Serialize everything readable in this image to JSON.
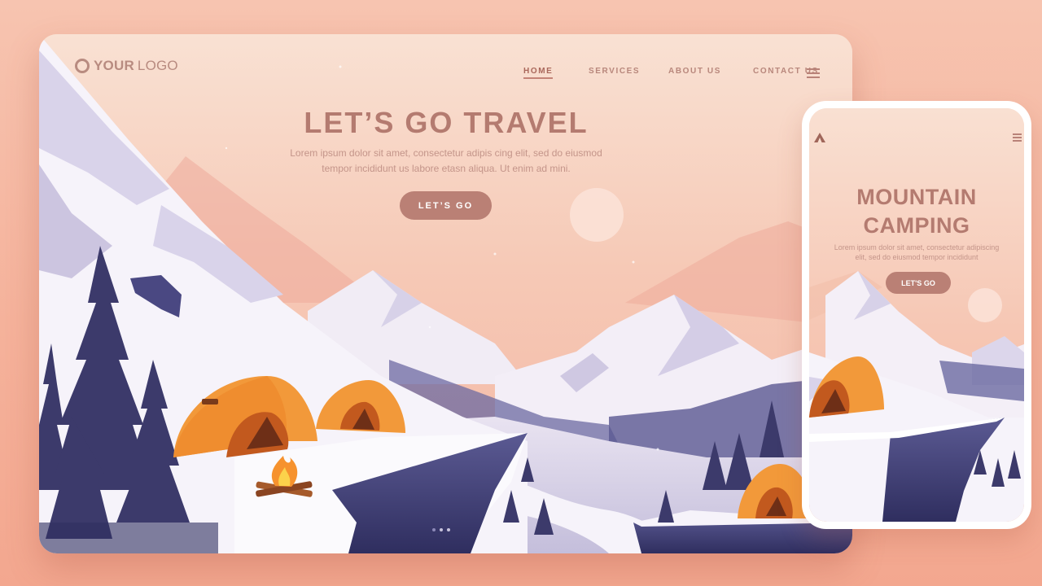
{
  "desktop": {
    "logo": {
      "bold": "YOUR",
      "regular": "LOGO"
    },
    "nav": [
      {
        "label": "HOME",
        "active": true
      },
      {
        "label": "SERVICES",
        "active": false
      },
      {
        "label": "ABOUT US",
        "active": false
      },
      {
        "label": "CONTACT US",
        "active": false
      }
    ],
    "hero": {
      "title": "LET’S GO TRAVEL",
      "subtitle_line1": "Lorem ipsum dolor sit amet, consectetur adipis cing elit, sed do eiusmod",
      "subtitle_line2": "tempor incididunt us labore etasn aliqua. Ut enim ad mini.",
      "button_label": "LET’S GO"
    },
    "carousel": {
      "slide_count": 3,
      "active_index": 0
    },
    "icons": [
      "logo-ring-icon",
      "menu-icon",
      "campfire-icon"
    ]
  },
  "mobile": {
    "title_line1": "MOUNTAIN",
    "title_line2": "CAMPING",
    "subtitle_line1": "Lorem ipsum dolor sit amet, consectetur adipiscing",
    "subtitle_line2": "elit, sed do eiusmod tempor incididunt",
    "button_label": "LET'S GO",
    "icons": [
      "tent-logo-icon",
      "menu-icon"
    ]
  },
  "colors": {
    "background": "#f5b29b",
    "sky_top": "#f9e1d3",
    "sky_bottom": "#f4b7a4",
    "title": "#b47b70",
    "button": "#ba8075",
    "tent": "#f29a3a",
    "tree": "#3c3a6b",
    "snow": "#ffffff",
    "cliff": "#3f3e77"
  }
}
